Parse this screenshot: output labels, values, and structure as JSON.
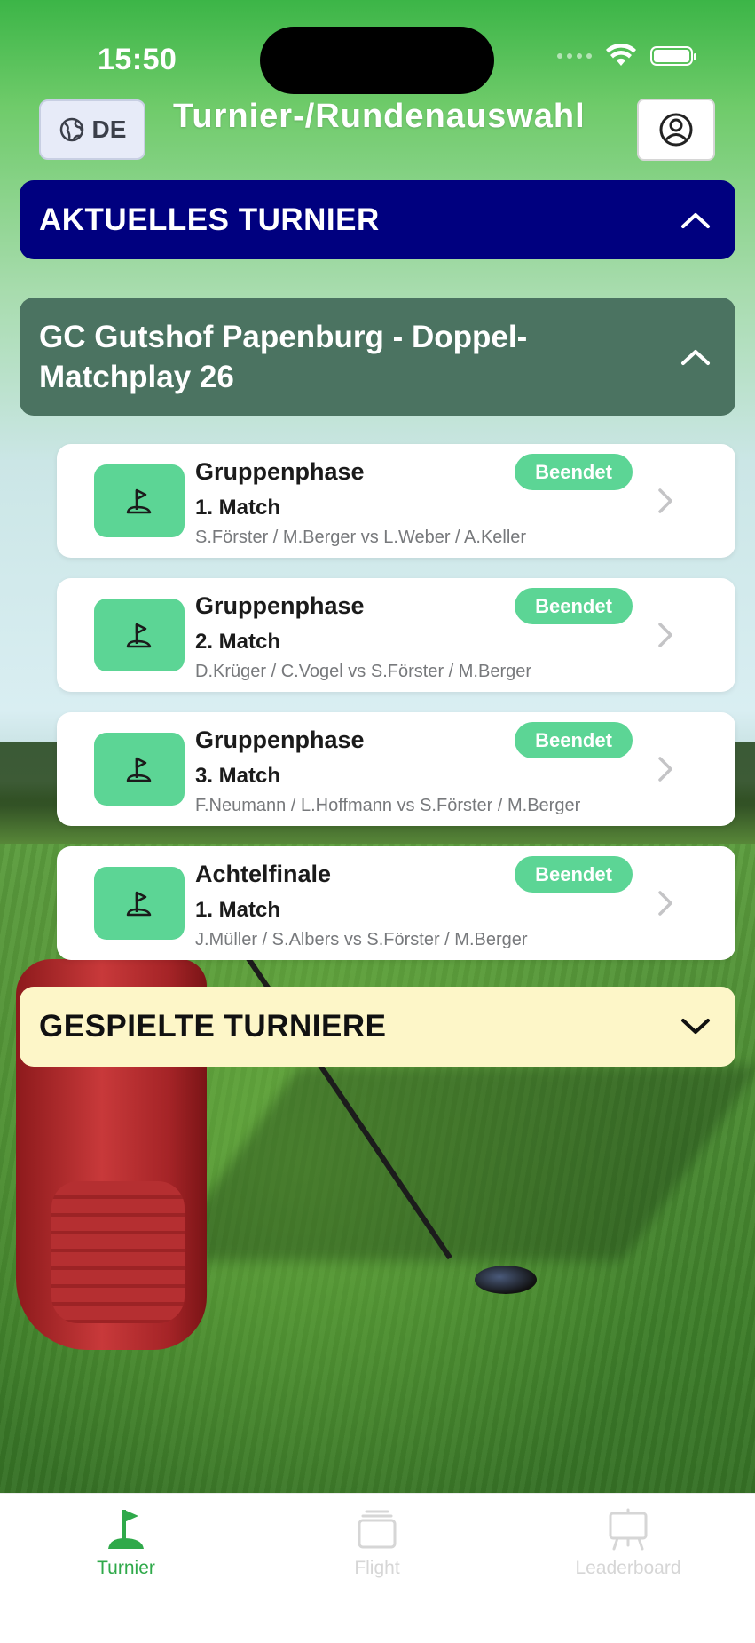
{
  "status_bar": {
    "time": "15:50"
  },
  "header": {
    "language_code": "DE",
    "title": "Turnier-/Rundenauswahl",
    "globe_icon": "globe-icon",
    "profile_icon": "person-circle-icon"
  },
  "current_section": {
    "label": "AKTUELLES TURNIER",
    "state_icon": "chevron-up-icon"
  },
  "tournament": {
    "name": "GC Gutshof Papenburg - Doppel-Matchplay 26",
    "state_icon": "chevron-up-icon"
  },
  "rounds": [
    {
      "phase": "Gruppenphase",
      "match": "1. Match",
      "players": "S.Förster / M.Berger vs L.Weber / A.Keller",
      "status": "Beendet"
    },
    {
      "phase": "Gruppenphase",
      "match": "2. Match",
      "players": "D.Krüger / C.Vogel vs S.Förster / M.Berger",
      "status": "Beendet"
    },
    {
      "phase": "Gruppenphase",
      "match": "3. Match",
      "players": "F.Neumann / L.Hoffmann vs S.Förster / M.Berger",
      "status": "Beendet"
    },
    {
      "phase": "Achtelfinale",
      "match": "1. Match",
      "players": "J.Müller / S.Albers vs S.Förster / M.Berger",
      "status": "Beendet"
    }
  ],
  "played_section": {
    "label": "GESPIELTE TURNIERE",
    "state_icon": "chevron-down-icon"
  },
  "tabbar": {
    "tabs": [
      {
        "label": "Turnier",
        "icon": "golf-flag-icon",
        "active": true
      },
      {
        "label": "Flight",
        "icon": "stack-icon",
        "active": false
      },
      {
        "label": "Leaderboard",
        "icon": "easel-board-icon",
        "active": false
      }
    ]
  },
  "colors": {
    "current_bar": "#00007f",
    "tournament_bar": "#4b7361",
    "played_bar": "#fdf6c8",
    "badge_green": "#5cd595",
    "active_tab": "#2fa94a"
  }
}
